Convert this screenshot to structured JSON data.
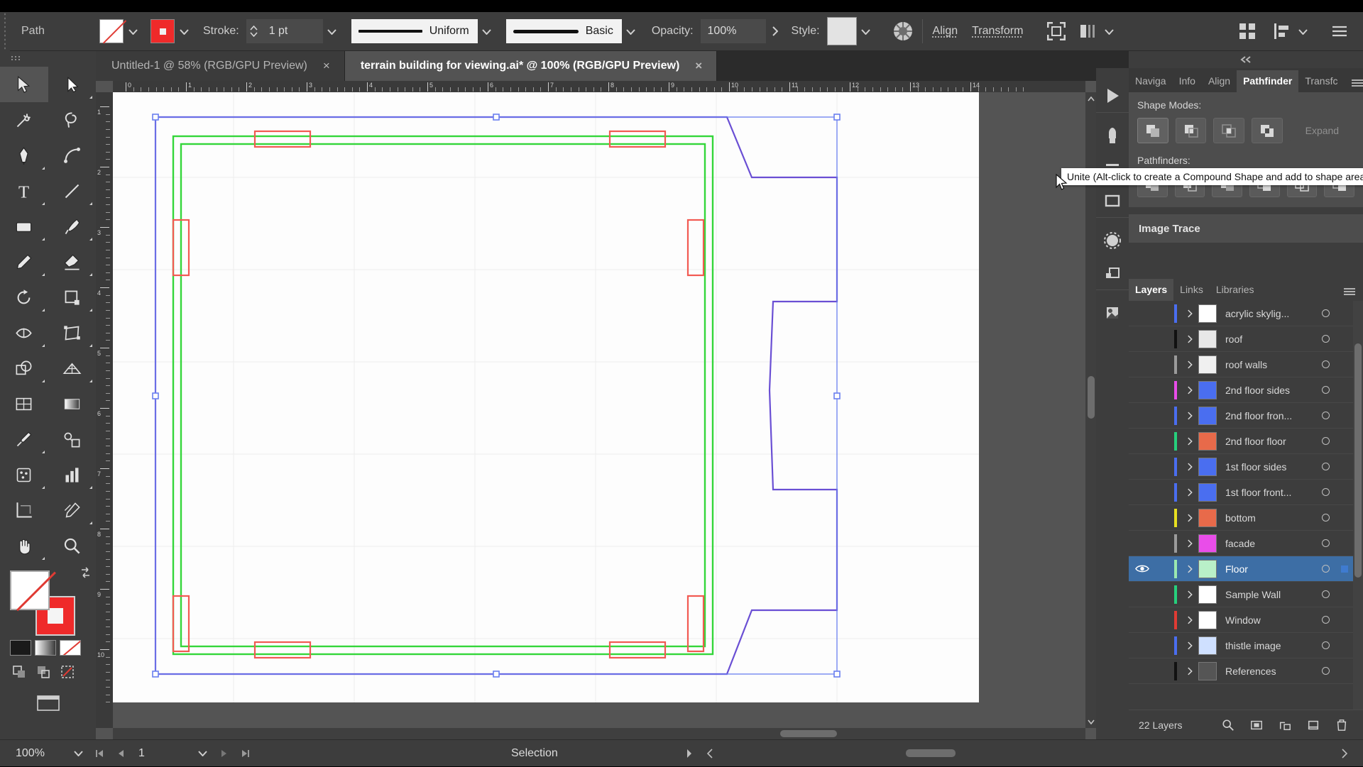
{
  "app": {
    "name": "Adobe Illustrator"
  },
  "control_bar": {
    "object_label": "Path",
    "fill_label": "fill-swatch-none",
    "stroke_label": "stroke-swatch-red",
    "stroke_text": "Stroke:",
    "stroke_weight": "1 pt",
    "stroke_profile": "Uniform",
    "brush_definition": "Basic",
    "opacity_label": "Opacity:",
    "opacity_value": "100%",
    "style_label": "Style:",
    "align_label": "Align",
    "transform_label": "Transform",
    "colors": {
      "stroke_red": "#ef2a2a",
      "panel_bg": "#3d3d3d",
      "accent_blue": "#3d6ea5"
    }
  },
  "tabs": [
    {
      "title": "Untitled-1 @ 58% (RGB/GPU Preview)",
      "close": "×",
      "active": false
    },
    {
      "title": "terrain building for viewing.ai* @ 100% (RGB/GPU Preview)",
      "close": "×",
      "active": true
    }
  ],
  "toolbox": {
    "tools": [
      "selection-tool",
      "direct-selection-tool",
      "magic-wand-tool",
      "lasso-tool",
      "pen-tool",
      "curvature-tool",
      "type-tool",
      "line-segment-tool",
      "rectangle-tool",
      "paintbrush-tool",
      "pencil-tool",
      "eraser-tool",
      "rotate-tool",
      "scale-tool",
      "width-tool",
      "free-transform-tool",
      "shape-builder-tool",
      "perspective-grid-tool",
      "mesh-tool",
      "gradient-tool",
      "eyedropper-tool",
      "blend-tool",
      "symbol-sprayer-tool",
      "column-graph-tool",
      "artboard-tool",
      "slice-tool",
      "hand-tool",
      "zoom-tool"
    ],
    "fill_stroke": {
      "fill": "none",
      "stroke": "#ef2a2a"
    },
    "mini_colors": [
      "#1a1a1a",
      "#9a9a9a",
      "#ffffff"
    ],
    "draw_modes": [
      "draw-normal",
      "draw-behind",
      "draw-inside"
    ],
    "screen_mode": "change-screen-mode"
  },
  "document": {
    "ruler_top_numbers": [
      "0",
      "1",
      "2",
      "3",
      "4",
      "5",
      "6",
      "7",
      "8",
      "9",
      "10",
      "11",
      "12",
      "13",
      "14"
    ],
    "ruler_left_numbers": [
      "1",
      "2",
      "3",
      "4",
      "5",
      "6",
      "7",
      "8",
      "9",
      "10"
    ],
    "artwork": "terrain building floor plan with green rectangles and red window markers"
  },
  "right_panel": {
    "collapse_icon": "«",
    "tabs": [
      {
        "label": "Naviga",
        "active": false
      },
      {
        "label": "Info",
        "active": false
      },
      {
        "label": "Align",
        "active": false
      },
      {
        "label": "Pathfinder",
        "active": true
      },
      {
        "label": "Transfс",
        "active": false
      }
    ],
    "pathfinder": {
      "shape_modes_label": "Shape Modes:",
      "expand_label": "Expand",
      "pathfinders_label": "Pathfinders:",
      "shape_mode_buttons": [
        "unite",
        "minus-front",
        "intersect",
        "exclude"
      ],
      "pathfinder_buttons": [
        "divide",
        "trim",
        "merge",
        "crop",
        "outline",
        "minus-back"
      ],
      "tooltip": "Unite (Alt-click to create a Compound Shape and add to shape area)"
    },
    "image_trace_label": "Image Trace",
    "layers_tabs": [
      {
        "label": "Layers",
        "active": true
      },
      {
        "label": "Links",
        "active": false
      },
      {
        "label": "Libraries",
        "active": false
      }
    ],
    "layers": [
      {
        "name": "acrylic skylig...",
        "color": "#4a6ef0",
        "visible": false,
        "selected": false,
        "thumb": "blank"
      },
      {
        "name": "roof",
        "color": "#111111",
        "visible": false,
        "selected": false,
        "thumb": "hatch"
      },
      {
        "name": "roof walls",
        "color": "#9b9b9b",
        "visible": false,
        "selected": false,
        "thumb": "lines"
      },
      {
        "name": "2nd floor sides",
        "color": "#e94de9",
        "visible": false,
        "selected": false,
        "thumb": "blue"
      },
      {
        "name": "2nd floor fron...",
        "color": "#4a6ef0",
        "visible": false,
        "selected": false,
        "thumb": "blue"
      },
      {
        "name": "2nd floor floor",
        "color": "#26d07c",
        "visible": false,
        "selected": false,
        "thumb": "red"
      },
      {
        "name": "1st floor sides",
        "color": "#4a6ef0",
        "visible": false,
        "selected": false,
        "thumb": "blue"
      },
      {
        "name": "1st floor front...",
        "color": "#4a6ef0",
        "visible": false,
        "selected": false,
        "thumb": "blue"
      },
      {
        "name": "bottom",
        "color": "#e8e020",
        "visible": false,
        "selected": false,
        "thumb": "red"
      },
      {
        "name": "facade",
        "color": "#9b9b9b",
        "visible": false,
        "selected": false,
        "thumb": "magenta"
      },
      {
        "name": "Floor",
        "color": "#9be8b0",
        "visible": true,
        "selected": true,
        "thumb": "green"
      },
      {
        "name": "Sample Wall",
        "color": "#26d07c",
        "visible": false,
        "selected": false,
        "thumb": "blank"
      },
      {
        "name": "Window",
        "color": "#e03b34",
        "visible": false,
        "selected": false,
        "thumb": "blank"
      },
      {
        "name": "thistle image",
        "color": "#4a6ef0",
        "visible": false,
        "selected": false,
        "thumb": "thistle"
      },
      {
        "name": "References",
        "color": "#111111",
        "visible": false,
        "selected": false,
        "thumb": "photo"
      }
    ],
    "layers_count": "22 Layers",
    "layers_footer_buttons": [
      "locate-object",
      "make-clipping-mask",
      "create-new-sublayer",
      "create-new-layer",
      "delete-selection"
    ]
  },
  "status_bar": {
    "zoom": "100%",
    "page_number": "1",
    "mode": "Selection",
    "first_icon": "first-page",
    "prev_icon": "previous-page",
    "next_icon": "next-page",
    "last_icon": "last-page"
  }
}
